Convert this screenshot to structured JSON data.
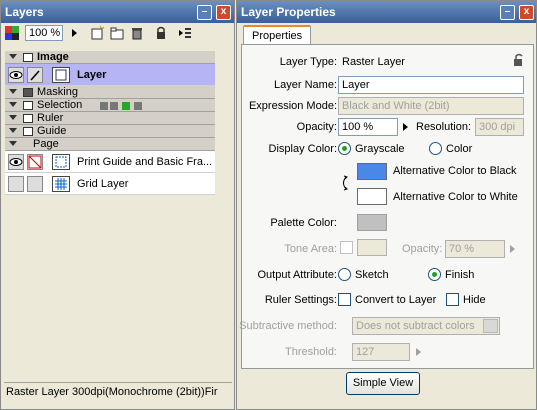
{
  "layers_panel": {
    "title": "Layers",
    "minimize_label": "–",
    "close_label": "x",
    "zoom": "100 %",
    "groups": {
      "image": "Image",
      "masking": "Masking",
      "selection": "Selection",
      "ruler": "Ruler",
      "guide": "Guide",
      "page": "Page"
    },
    "layers": [
      {
        "name": "Layer",
        "selected": true
      },
      {
        "name": "Print Guide and Basic Fra..."
      },
      {
        "name": "Grid Layer"
      }
    ],
    "status": "Raster Layer 300dpi(Monochrome (2bit))Fir"
  },
  "props_panel": {
    "title": "Layer Properties",
    "minimize_label": "–",
    "close_label": "x",
    "tab": "Properties",
    "layer_type_label": "Layer Type:",
    "layer_type_value": "Raster Layer",
    "layer_name_label": "Layer Name:",
    "layer_name_value": "Layer",
    "expression_mode_label": "Expression Mode:",
    "expression_mode_value": "Black and White (2bit)",
    "opacity_label": "Opacity:",
    "opacity_value": "100 %",
    "resolution_label": "Resolution:",
    "resolution_value": "300 dpi",
    "display_color_label": "Display Color:",
    "grayscale_label": "Grayscale",
    "color_label": "Color",
    "alt_black_label": "Alternative Color to Black",
    "alt_white_label": "Alternative Color to White",
    "palette_color_label": "Palette Color:",
    "tone_area_label": "Tone Area:",
    "tone_opacity_label": "Opacity:",
    "tone_opacity_value": "70 %",
    "output_attribute_label": "Output Attribute:",
    "sketch_label": "Sketch",
    "finish_label": "Finish",
    "ruler_settings_label": "Ruler Settings:",
    "convert_to_layer_label": "Convert to Layer",
    "hide_label": "Hide",
    "subtractive_label": "Subtractive method:",
    "subtractive_value": "Does not subtract colors",
    "threshold_label": "Threshold:",
    "threshold_value": "127",
    "simple_view_label": "Simple View"
  },
  "colors": {
    "alt_black": "#4a88e8",
    "alt_white": "#ffffff",
    "palette": "#c0c0c0",
    "selected_layer_bg": "#b7b4f4",
    "title_bar": "#3a5f9a"
  }
}
